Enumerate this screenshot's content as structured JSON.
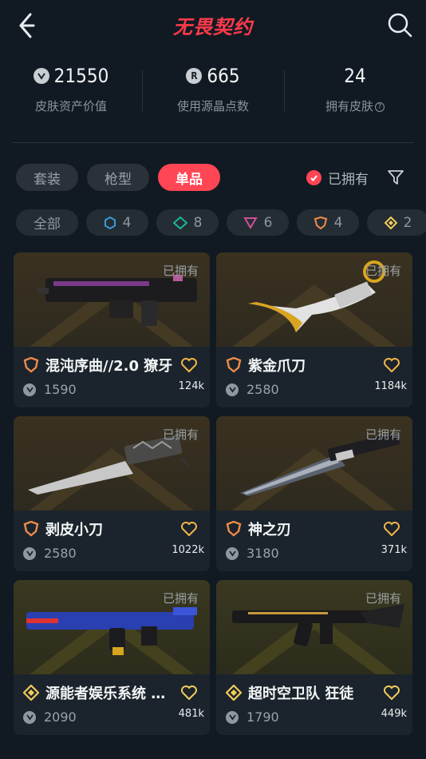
{
  "header": {
    "title": "无畏契约"
  },
  "stats": [
    {
      "value": "21550",
      "label": "皮肤资产价值",
      "icon": "vp-coin-icon"
    },
    {
      "value": "665",
      "label": "使用源晶点数",
      "icon": "radianite-icon"
    },
    {
      "value": "24",
      "label": "拥有皮肤",
      "icon": ""
    }
  ],
  "tabs": [
    {
      "label": "套装",
      "active": false
    },
    {
      "label": "枪型",
      "active": false
    },
    {
      "label": "单品",
      "active": true
    }
  ],
  "owned_filter": {
    "label": "已拥有",
    "checked": true
  },
  "tiers": [
    {
      "label": "全部"
    },
    {
      "count": "4",
      "icon": "select-tier-icon",
      "color": "#3a9ad9"
    },
    {
      "count": "8",
      "icon": "deluxe-tier-icon",
      "color": "#1bb59a"
    },
    {
      "count": "6",
      "icon": "premium-tier-icon",
      "color": "#d04f9a"
    },
    {
      "count": "4",
      "icon": "exclusive-tier-icon",
      "color": "#f08a4b"
    },
    {
      "count": "2",
      "icon": "ultra-tier-icon",
      "color": "#f3cd5a"
    }
  ],
  "cards": [
    {
      "name": "混沌序曲//2.0 獠牙",
      "price": "1590",
      "likes": "124k",
      "owned": "已拥有",
      "tier": "exclusive",
      "tier_color": "#f08a4b",
      "weapon": "rifle-dark"
    },
    {
      "name": "紫金爪刀",
      "price": "2580",
      "likes": "1184k",
      "owned": "已拥有",
      "tier": "exclusive",
      "tier_color": "#f08a4b",
      "weapon": "karambit"
    },
    {
      "name": "剥皮小刀",
      "price": "2580",
      "likes": "1022k",
      "owned": "已拥有",
      "tier": "exclusive",
      "tier_color": "#f08a4b",
      "weapon": "knife"
    },
    {
      "name": "神之刃",
      "price": "3180",
      "likes": "371k",
      "owned": "已拥有",
      "tier": "exclusive",
      "tier_color": "#f08a4b",
      "weapon": "blade"
    },
    {
      "name": "源能者娱乐系统 冥驹",
      "price": "2090",
      "likes": "481k",
      "owned": "已拥有",
      "tier": "ultra",
      "tier_color": "#f3cd5a",
      "weapon": "rifle-blue"
    },
    {
      "name": "超时空卫队 狂徒",
      "price": "1790",
      "likes": "449k",
      "owned": "已拥有",
      "tier": "ultra",
      "tier_color": "#f3cd5a",
      "weapon": "vandal"
    }
  ]
}
